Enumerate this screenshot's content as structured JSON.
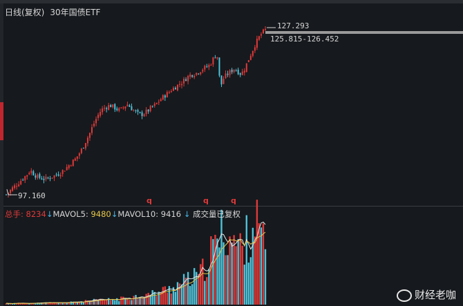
{
  "header": {
    "period_label": "日线(复权)",
    "security_name": "30年国债ETF"
  },
  "price_chart": {
    "high_label": "127.293",
    "current_range_label": "125.815-126.452",
    "low_label": "97.160",
    "signal_markers": [
      "q",
      "q",
      "q"
    ]
  },
  "volume_header": {
    "total_label": "总手:",
    "total_value": "8234",
    "mavol5_label": "MAVOL5:",
    "mavol5_value": "9480",
    "mavol10_label": "MAVOL10:",
    "mavol10_value": "9416",
    "note": "成交量已复权"
  },
  "colors": {
    "up": "#e03a3a",
    "down": "#4fc3d9",
    "background": "#16191d",
    "ma_line": "#e8e8e8"
  },
  "watermark": {
    "text": "财经老咖",
    "icon": "weibo-icon"
  },
  "chart_data": [
    {
      "type": "candlestick",
      "title": "日线(复权) 30年国债ETF",
      "x": "trading days",
      "y_range": [
        97.16,
        127.293
      ],
      "series": [
        {
          "close_path": [
            97.2,
            97.8,
            98.5,
            99.0,
            99.6,
            100.2,
            100.8,
            101.6,
            100.9,
            100.4,
            100.2,
            100.0,
            100.1,
            100.4,
            100.6,
            100.9,
            101.3,
            101.8,
            102.4,
            103.0,
            103.6,
            104.5,
            105.5,
            106.8,
            108.0,
            109.5,
            110.8,
            112.0,
            112.7,
            113.0,
            113.3,
            113.0,
            112.6,
            112.4,
            113.0,
            113.5,
            112.9,
            112.3,
            111.8,
            111.6,
            111.9,
            112.3,
            112.9,
            113.3,
            113.9,
            114.6,
            115.1,
            115.6,
            116.2,
            116.6,
            117.1,
            117.5,
            118.1,
            118.7,
            118.9,
            119.1,
            119.5,
            119.9,
            120.2,
            120.6,
            121.8,
            122.6,
            116.6,
            118.3,
            118.9,
            119.4,
            119.9,
            119.4,
            118.9,
            119.9,
            121.4,
            122.8,
            124.2,
            125.4,
            126.3,
            126.9
          ]
        }
      ]
    },
    {
      "type": "bar",
      "title": "成交量",
      "x": "trading days",
      "series": [
        {
          "name": "成交量",
          "values": [
            210,
            220,
            200,
            230,
            250,
            240,
            260,
            250,
            270,
            260,
            280,
            300,
            310,
            300,
            320,
            330,
            350,
            360,
            380,
            420,
            460,
            500,
            560,
            600,
            650,
            700,
            760,
            800,
            820,
            840,
            860,
            900,
            950,
            1000,
            1100,
            1200,
            1300,
            1400,
            1500,
            1600,
            1700,
            1800,
            1900,
            2000,
            2200,
            2400,
            2600,
            2800,
            3000,
            3300,
            3600,
            3900,
            4200,
            4400,
            4600,
            4800,
            5200,
            6000,
            7500,
            8800,
            9800,
            11000,
            12200,
            13000,
            12600,
            11800,
            11000,
            10400,
            10000,
            10800,
            12000,
            13600,
            14800,
            13600,
            12000,
            8234
          ]
        }
      ]
    }
  ]
}
